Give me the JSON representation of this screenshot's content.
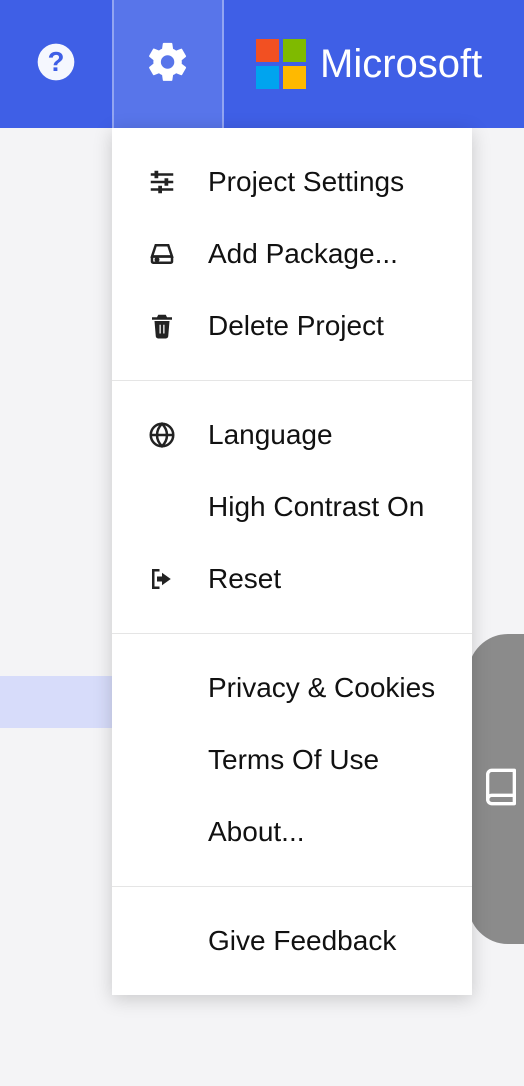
{
  "brand": {
    "name": "Microsoft"
  },
  "menu": {
    "sections": [
      [
        {
          "key": "project-settings",
          "label": "Project Settings",
          "icon": "sliders"
        },
        {
          "key": "add-package",
          "label": "Add Package...",
          "icon": "drive"
        },
        {
          "key": "delete-project",
          "label": "Delete Project",
          "icon": "trash"
        }
      ],
      [
        {
          "key": "language",
          "label": "Language",
          "icon": "globe"
        },
        {
          "key": "high-contrast",
          "label": "High Contrast On",
          "icon": ""
        },
        {
          "key": "reset",
          "label": "Reset",
          "icon": "signout"
        }
      ],
      [
        {
          "key": "privacy",
          "label": "Privacy & Cookies",
          "icon": ""
        },
        {
          "key": "terms",
          "label": "Terms Of Use",
          "icon": ""
        },
        {
          "key": "about",
          "label": "About...",
          "icon": ""
        }
      ],
      [
        {
          "key": "feedback",
          "label": "Give Feedback",
          "icon": ""
        }
      ]
    ]
  }
}
